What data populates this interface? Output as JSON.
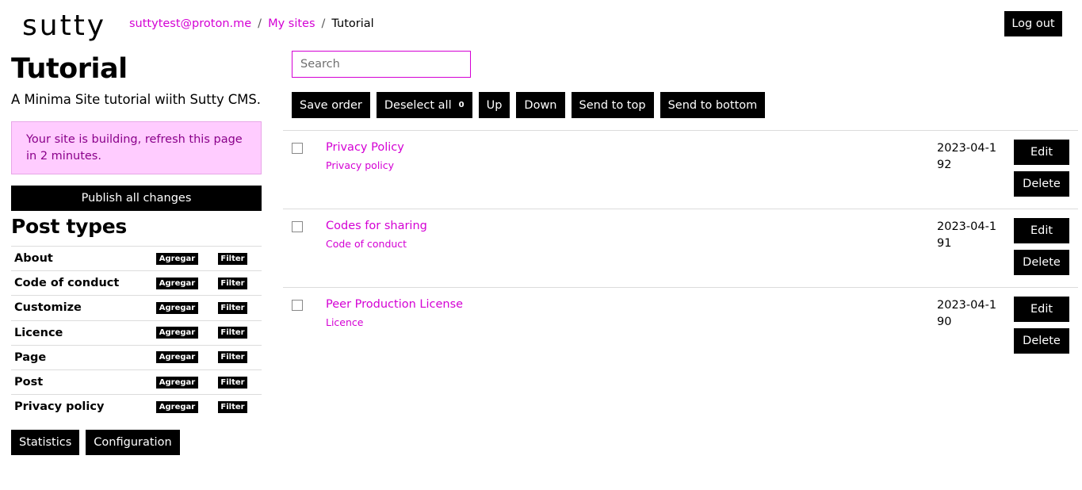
{
  "logo": {
    "text": "sutty"
  },
  "breadcrumb": {
    "user": "suttytest@proton.me",
    "sites": "My sites",
    "current": "Tutorial",
    "separator": "/"
  },
  "header": {
    "logout_label": "Log out"
  },
  "site": {
    "title": "Tutorial",
    "description": "A Minima Site tutorial wiith Sutty CMS.",
    "alert": "Your site is building, refresh this page in 2 minutes.",
    "publish_label": "Publish all changes"
  },
  "post_types": {
    "heading": "Post types",
    "add_label": "Agregar",
    "filter_label": "Filter",
    "items": [
      {
        "name": "About"
      },
      {
        "name": "Code of conduct"
      },
      {
        "name": "Customize"
      },
      {
        "name": "Licence"
      },
      {
        "name": "Page"
      },
      {
        "name": "Post"
      },
      {
        "name": "Privacy policy"
      }
    ]
  },
  "sidebar_footer": {
    "statistics_label": "Statistics",
    "configuration_label": "Configuration"
  },
  "search": {
    "placeholder": "Search",
    "value": ""
  },
  "toolbar": {
    "save_order": "Save order",
    "deselect_all": "Deselect all",
    "selected_count": "0",
    "up": "Up",
    "down": "Down",
    "send_to_top": "Send to top",
    "send_to_bottom": "Send to bottom"
  },
  "actions": {
    "edit_label": "Edit",
    "delete_label": "Delete"
  },
  "posts": [
    {
      "title": "Privacy Policy",
      "type": "Privacy policy",
      "date": "2023-04-192"
    },
    {
      "title": "Codes for sharing",
      "type": "Code of conduct",
      "date": "2023-04-191"
    },
    {
      "title": "Peer Production License",
      "type": "Licence",
      "date": "2023-04-190"
    }
  ],
  "colors": {
    "accent": "#d400d4",
    "alert_bg": "#ffccff",
    "alert_text": "#8a008a",
    "button_bg": "#000000"
  }
}
